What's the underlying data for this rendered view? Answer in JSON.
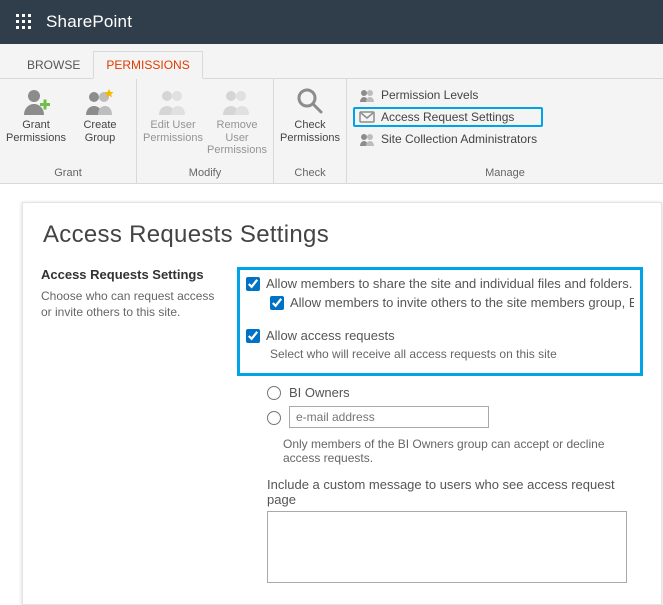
{
  "suite": {
    "title": "SharePoint"
  },
  "tabs": {
    "browse": "BROWSE",
    "permissions": "PERMISSIONS"
  },
  "ribbon": {
    "grant": {
      "grant_permissions": "Grant\nPermissions",
      "create_group": "Create\nGroup",
      "label": "Grant"
    },
    "modify": {
      "edit_user": "Edit User\nPermissions",
      "remove_user": "Remove User\nPermissions",
      "label": "Modify"
    },
    "check": {
      "check_permissions": "Check\nPermissions",
      "label": "Check"
    },
    "manage": {
      "permission_levels": "Permission Levels",
      "access_request_settings": "Access Request Settings",
      "site_collection_admins": "Site Collection Administrators",
      "label": "Manage"
    }
  },
  "page": {
    "title": "Access Requests Settings",
    "section_title": "Access Requests Settings",
    "section_desc": "Choose who can request access or invite others to this site.",
    "allow_share": "Allow members to share the site and individual files and folders.",
    "allow_invite": "Allow members to invite others to the site members group, BI Members. This",
    "allow_access_requests": "Allow access requests",
    "select_who": "Select who will receive all access requests on this site",
    "radio_owners": "BI Owners",
    "email_placeholder": "e-mail address",
    "only_members_hint": "Only members of the BI Owners group can accept or decline access requests.",
    "include_msg_label": "Include a custom message to users who see access request page"
  }
}
